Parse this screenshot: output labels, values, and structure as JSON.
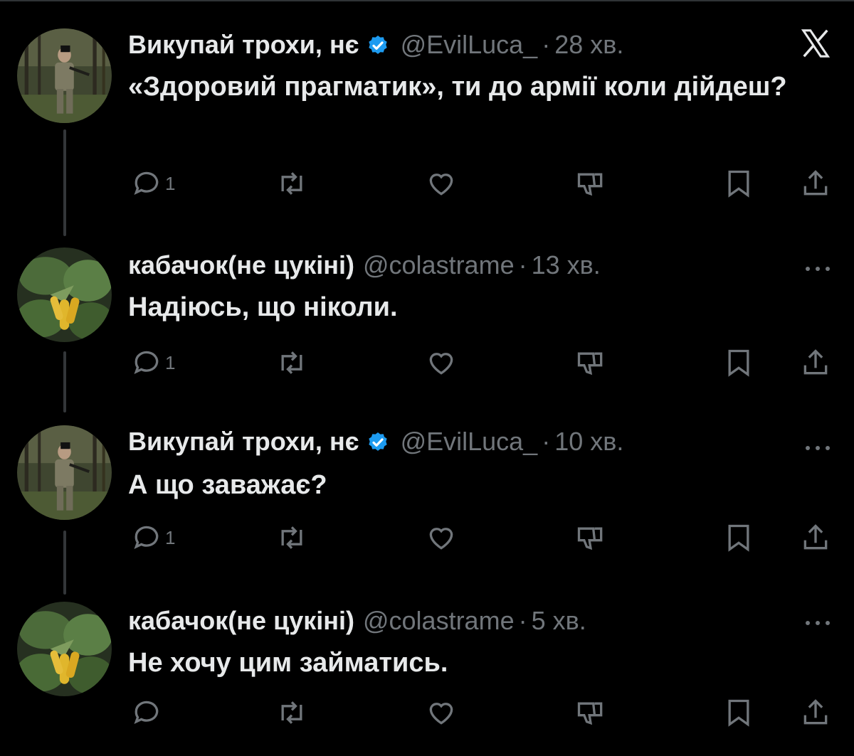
{
  "colors": {
    "background": "#000000",
    "text": "#e7e9ea",
    "muted": "#71767b",
    "verified": "#1d9bf0",
    "thread_line": "#333639"
  },
  "header_corner": {
    "logo": "x-logo-icon"
  },
  "tweets": [
    {
      "display_name": "Викупай трохи, нє",
      "verified": true,
      "handle": "@EvilLuca_",
      "dot": "·",
      "time": "28 хв.",
      "text": "«Здоровий прагматик», ти до армії коли дійдеш?",
      "reply_count": "1",
      "avatar": "soldier-in-forest",
      "corner": "x-logo-icon"
    },
    {
      "display_name": "кабачок(не цукіні)",
      "verified": false,
      "handle": "@colastrame",
      "dot": "·",
      "time": "13 хв.",
      "text": "Надіюсь, що ніколи.",
      "reply_count": "1",
      "avatar": "zucchini-plant",
      "corner": "more-icon"
    },
    {
      "display_name": "Викупай трохи, нє",
      "verified": true,
      "handle": "@EvilLuca_",
      "dot": "·",
      "time": "10 хв.",
      "text": "А що заважає?",
      "reply_count": "1",
      "avatar": "soldier-in-forest",
      "corner": "more-icon"
    },
    {
      "display_name": "кабачок(не цукіні)",
      "verified": false,
      "handle": "@colastrame",
      "dot": "·",
      "time": "5 хв.",
      "text": "Не хочу цим займатись.",
      "reply_count": "",
      "avatar": "zucchini-plant",
      "corner": "more-icon"
    }
  ]
}
